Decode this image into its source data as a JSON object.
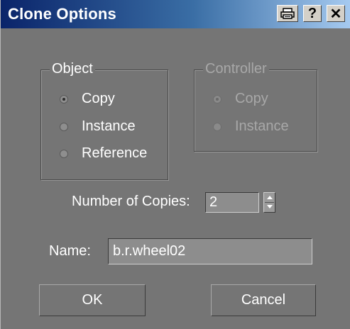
{
  "window": {
    "title": "Clone Options"
  },
  "titlebar_buttons": [
    {
      "name": "print",
      "icon": "printer-icon",
      "glyph": "🖶"
    },
    {
      "name": "help",
      "icon": "help-icon",
      "glyph": "?"
    },
    {
      "name": "close",
      "icon": "close-icon",
      "glyph": "✕"
    }
  ],
  "object_group": {
    "legend": "Object",
    "options": [
      {
        "label": "Copy",
        "selected": true
      },
      {
        "label": "Instance",
        "selected": false
      },
      {
        "label": "Reference",
        "selected": false
      }
    ]
  },
  "controller_group": {
    "legend": "Controller",
    "enabled": false,
    "options": [
      {
        "label": "Copy",
        "selected": true
      },
      {
        "label": "Instance",
        "selected": false
      }
    ]
  },
  "copies": {
    "label": "Number of Copies:",
    "value": "2"
  },
  "name": {
    "label": "Name:",
    "value": "b.r.wheel02"
  },
  "buttons": {
    "ok": "OK",
    "cancel": "Cancel"
  }
}
